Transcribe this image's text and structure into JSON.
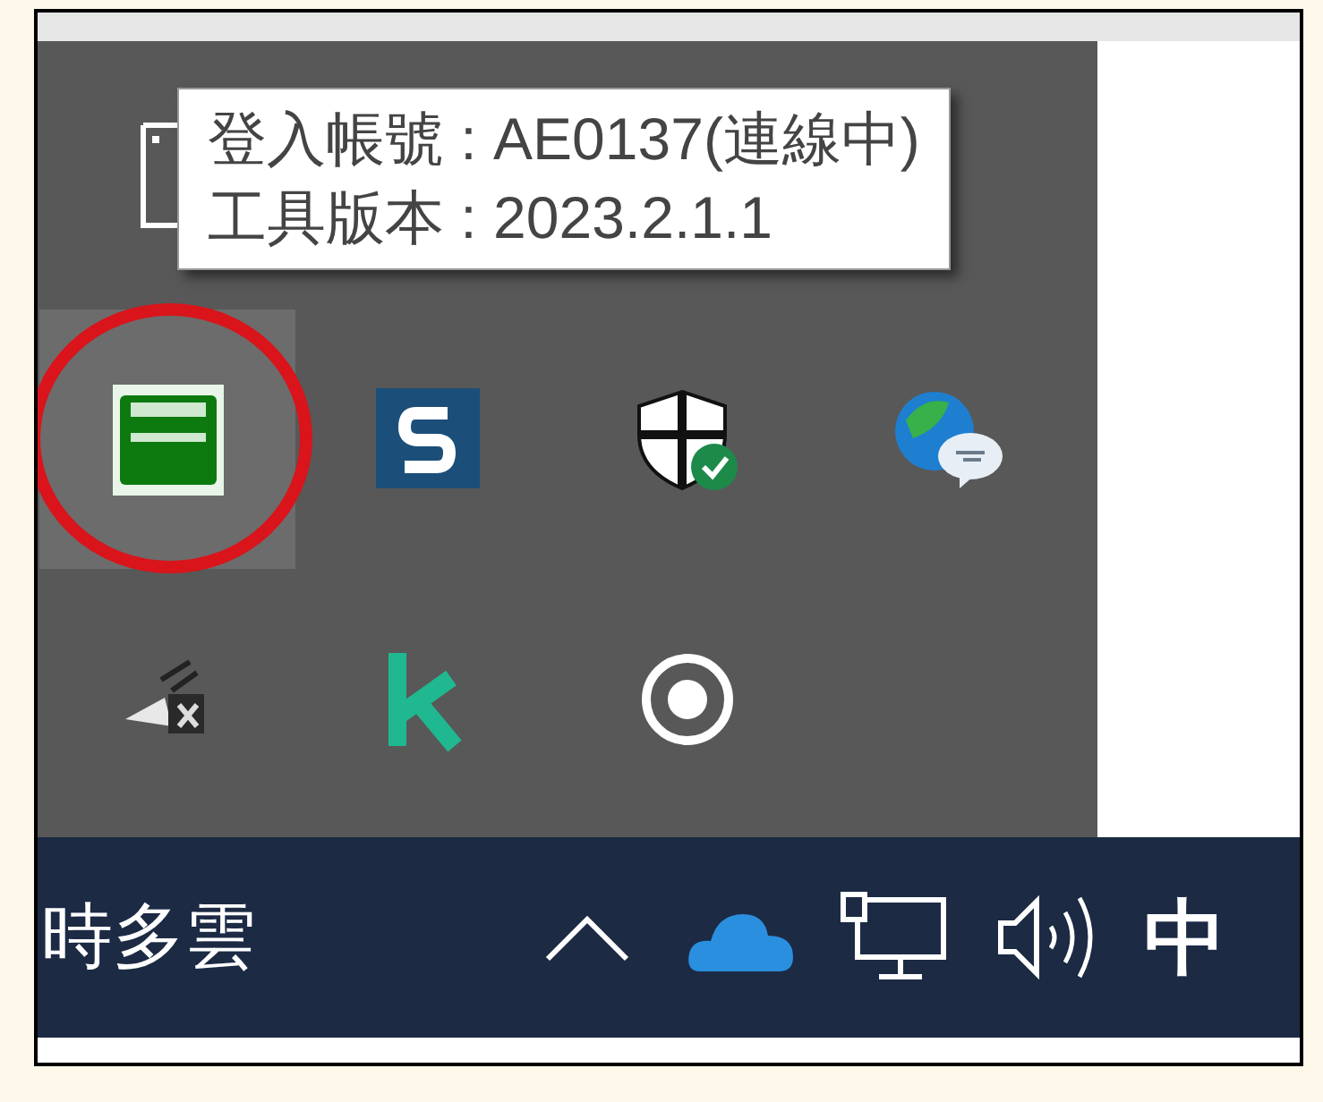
{
  "tooltip": {
    "lines": [
      "登入帳號 : AE0137(連線中)",
      "工具版本 : 2023.2.1.1"
    ]
  },
  "tray_overflow": {
    "icons": [
      {
        "kind": "green-app",
        "selected": true,
        "circled": true
      },
      {
        "kind": "s-app",
        "selected": false,
        "circled": false
      },
      {
        "kind": "shield",
        "selected": false,
        "circled": false
      },
      {
        "kind": "globe-chat",
        "selected": false,
        "circled": false
      },
      {
        "kind": "hardware",
        "selected": false,
        "circled": false
      },
      {
        "kind": "k-app",
        "selected": false,
        "circled": false
      },
      {
        "kind": "record",
        "selected": false,
        "circled": false
      }
    ]
  },
  "taskbar": {
    "weather": "時多雲",
    "input_method": "中"
  }
}
